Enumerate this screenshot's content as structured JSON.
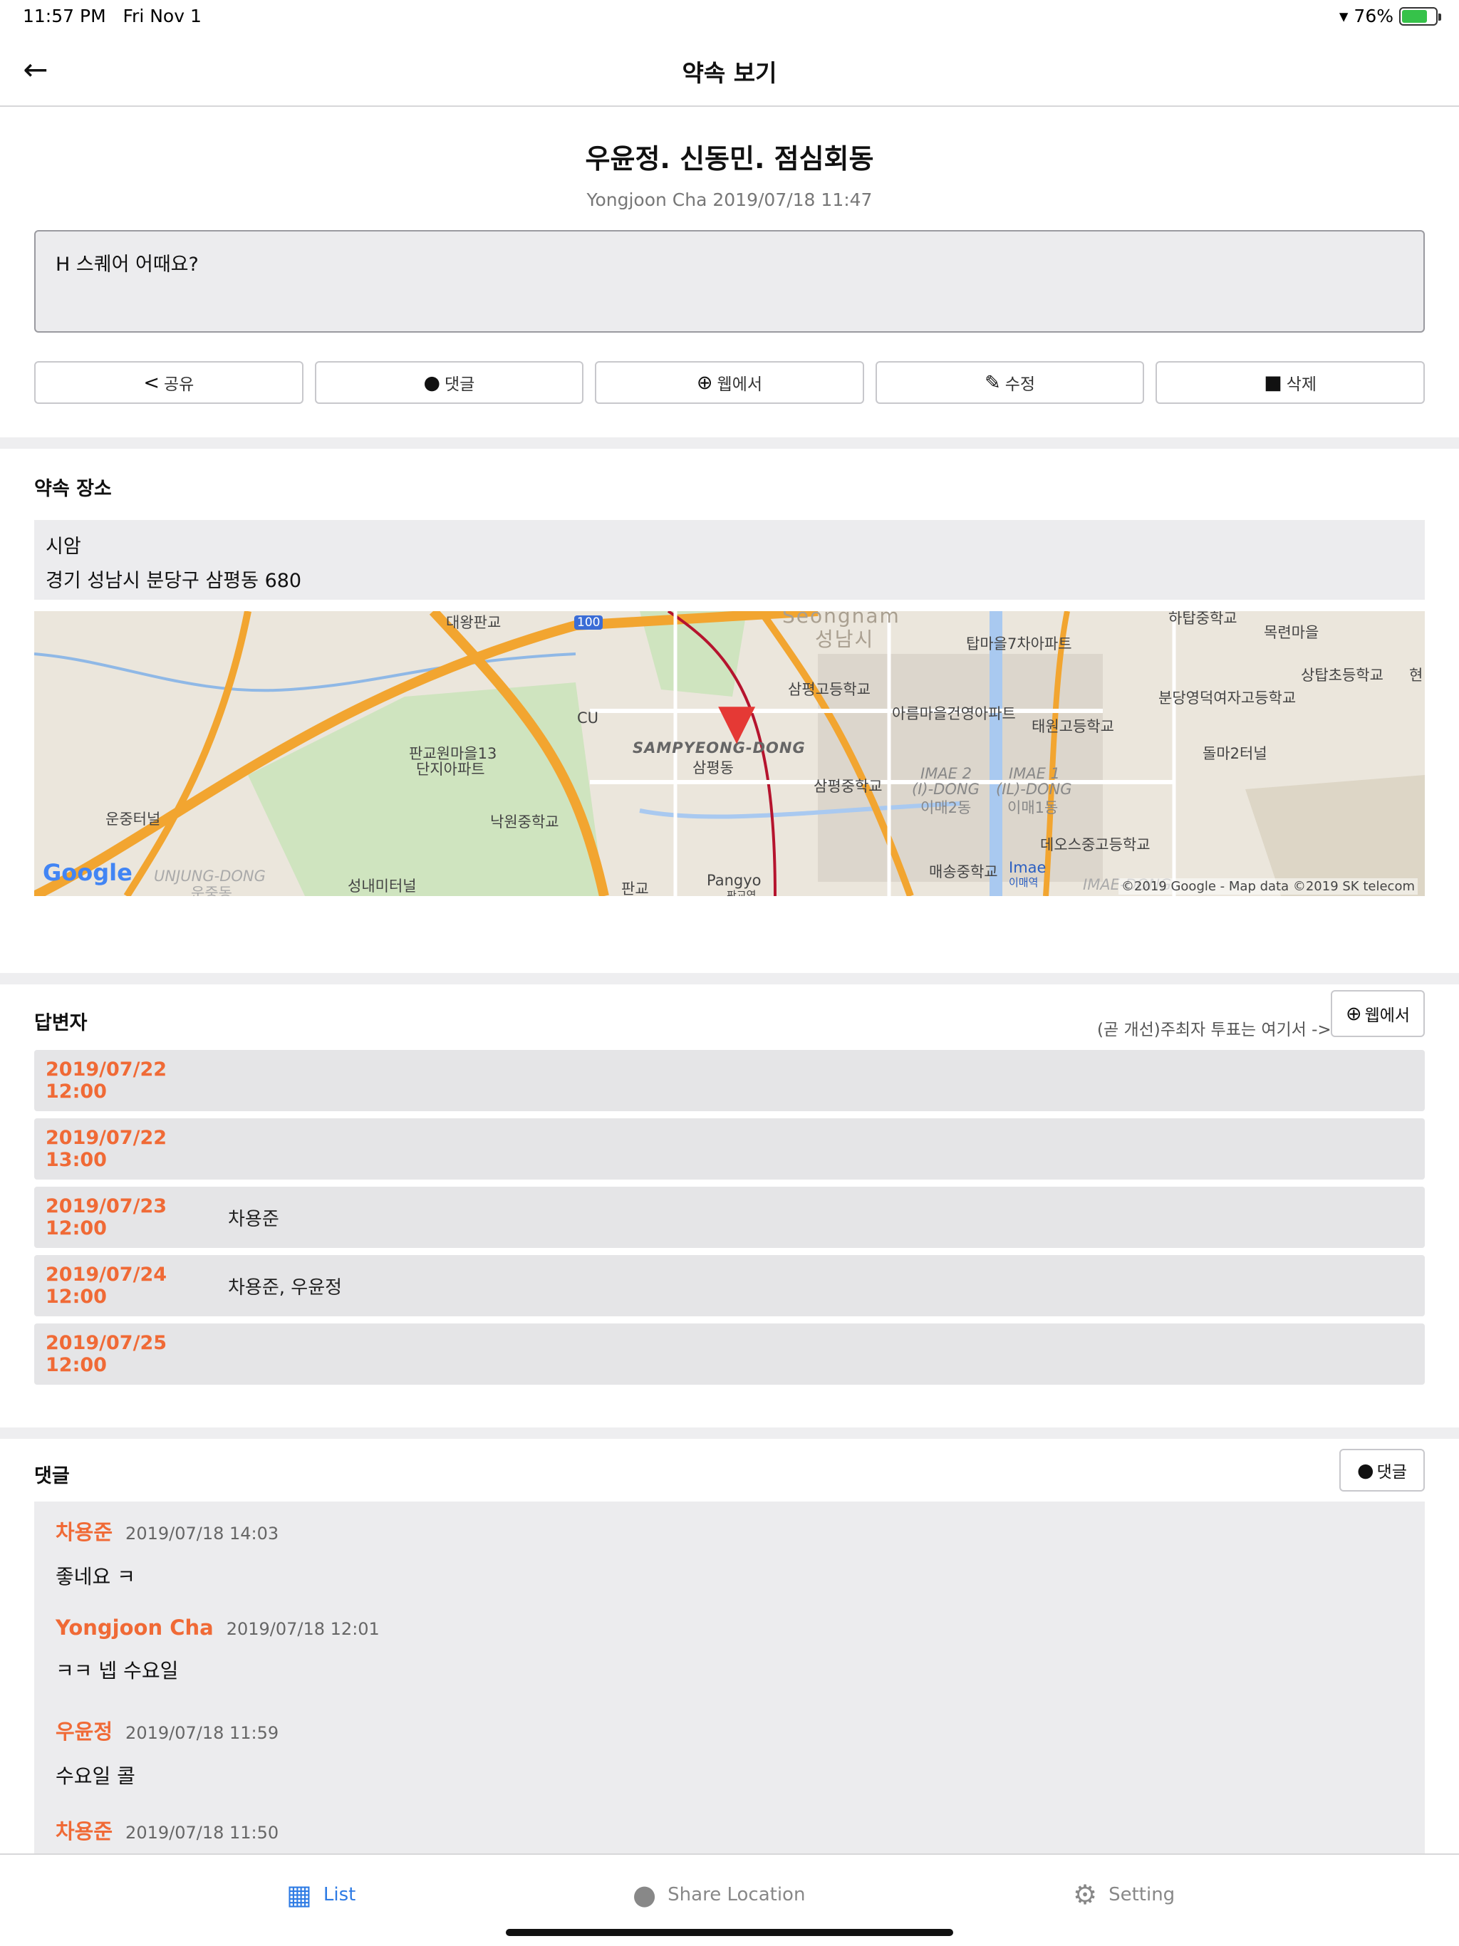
{
  "status_bar": {
    "time": "11:57 PM",
    "date": "Fri Nov 1",
    "battery": "76%",
    "battery_level": 0.76
  },
  "nav": {
    "title": "약속 보기"
  },
  "event": {
    "title": "우윤정. 신동민. 점심회동",
    "meta": "Yongjoon Cha 2019/07/18 11:47",
    "note": "H 스퀘어 어때요?"
  },
  "actions": [
    {
      "label": "공유",
      "icon": "share-icon"
    },
    {
      "label": "댓글",
      "icon": "comment-icon"
    },
    {
      "label": "웹에서",
      "icon": "globe-icon"
    },
    {
      "label": "수정",
      "icon": "edit-icon"
    },
    {
      "label": "삭제",
      "icon": "trash-icon"
    }
  ],
  "place": {
    "heading": "약속 장소",
    "name": "시암",
    "address": "경기 성남시 분당구 삼평동 680"
  },
  "map": {
    "labels": {
      "seongnam": "Seongnam",
      "seongnam_kr": "성남시",
      "sampyeong_dong": "SAMPYEONG-DONG",
      "sampyeong_kr": "삼평동",
      "daewang": "대왕판교",
      "road100": "100",
      "cu": "CU",
      "pangyo_apt": "판교원마을13",
      "pangyo_apt2": "단지아파트",
      "unjung_tunnel": "운중터널",
      "nakwon": "낙원중학교",
      "sampyeong_high": "삼평고등학교",
      "sampyeong_mid": "삼평중학교",
      "tapmaeul": "탑마을7차아파트",
      "areum": "아름마을건영아파트",
      "taewon": "태원고등학교",
      "imae2": "IMAE 2",
      "imae2b": "(I)-DONG",
      "imae2kr": "이매2동",
      "imae1": "IMAE 1",
      "imae1b": "(IL)-DONG",
      "imae1kr": "이매1동",
      "hatap": "하탑중학교",
      "mokryeon": "목련마을",
      "sangtap": "상탑초등학교",
      "hyeon": "현",
      "bundang_girls": "분당영덕여자고등학교",
      "dolma": "돌마2터널",
      "deoseu": "데오스중고등학교",
      "maesong": "매송중학교",
      "imae_station": "Imae",
      "imae_station_kr": "이매역",
      "unjung_dong": "UNJUNG-DONG",
      "unjung_kr": "운중동",
      "seongnae": "성내미터널",
      "pangyo": "Pangyo",
      "pangyo_kr": "판교역",
      "pangyo_small": "판교",
      "imae_dong": "IMAE-DONG",
      "google": "Google",
      "attribution": "©2019 Google - Map data ©2019 SK telecom"
    }
  },
  "responders": {
    "heading": "답변자",
    "vote_note": "(곧 개선)주최자 투표는 여기서 ->",
    "web_button": "웹에서",
    "slots": [
      {
        "time": "2019/07/22 12:00",
        "people": ""
      },
      {
        "time": "2019/07/22 13:00",
        "people": ""
      },
      {
        "time": "2019/07/23 12:00",
        "people": "차용준"
      },
      {
        "time": "2019/07/24 12:00",
        "people": "차용준, 우윤정"
      },
      {
        "time": "2019/07/25 12:00",
        "people": ""
      }
    ]
  },
  "comments": {
    "heading": "댓글",
    "button": "댓글",
    "items": [
      {
        "author": "차용준",
        "date": "2019/07/18 14:03",
        "text": "좋네요 ㅋ"
      },
      {
        "author": "Yongjoon Cha",
        "date": "2019/07/18 12:01",
        "text": "ㅋㅋ 넵 수요일"
      },
      {
        "author": "우윤정",
        "date": "2019/07/18 11:59",
        "text": "수요일 콜"
      },
      {
        "author": "차용준",
        "date": "2019/07/18 11:50",
        "text": ""
      }
    ]
  },
  "tabs": [
    {
      "label": "List",
      "icon": "calendar-icon",
      "active": true
    },
    {
      "label": "Share Location",
      "icon": "location-pin-icon",
      "active": false
    },
    {
      "label": "Setting",
      "icon": "gear-icon",
      "active": false
    }
  ],
  "colors": {
    "accent": "#2e7be4",
    "highlight": "#f06a36",
    "pin": "#e53935"
  }
}
